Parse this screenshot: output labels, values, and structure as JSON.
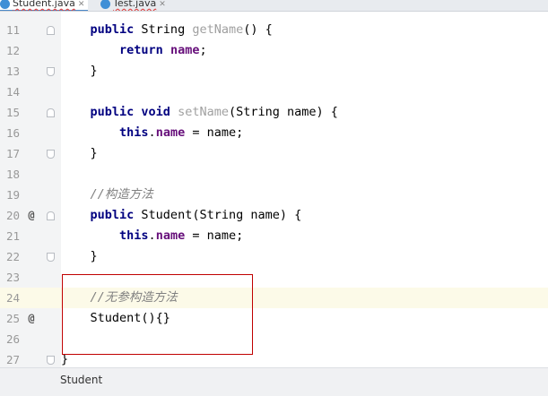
{
  "tabs": [
    {
      "label": "Student.java"
    },
    {
      "label": "Test.java"
    }
  ],
  "editor": {
    "current_line_number": "24",
    "lines": [
      {
        "num": "11",
        "indent": "    ",
        "tokens": [
          {
            "t": "public",
            "c": "kw"
          },
          {
            "t": " String ",
            "c": ""
          },
          {
            "t": "getName",
            "c": "fn"
          },
          {
            "t": "() {",
            "c": ""
          }
        ]
      },
      {
        "num": "12",
        "indent": "        ",
        "tokens": [
          {
            "t": "return",
            "c": "kw"
          },
          {
            "t": " ",
            "c": ""
          },
          {
            "t": "name",
            "c": "fld"
          },
          {
            "t": ";",
            "c": ""
          }
        ]
      },
      {
        "num": "13",
        "indent": "    ",
        "tokens": [
          {
            "t": "}",
            "c": ""
          }
        ]
      },
      {
        "num": "14",
        "indent": "",
        "tokens": []
      },
      {
        "num": "15",
        "indent": "    ",
        "tokens": [
          {
            "t": "public void",
            "c": "kw"
          },
          {
            "t": " ",
            "c": ""
          },
          {
            "t": "setName",
            "c": "fn"
          },
          {
            "t": "(String name) {",
            "c": ""
          }
        ]
      },
      {
        "num": "16",
        "indent": "        ",
        "tokens": [
          {
            "t": "this",
            "c": "kw"
          },
          {
            "t": ".",
            "c": ""
          },
          {
            "t": "name",
            "c": "fld"
          },
          {
            "t": " = name;",
            "c": ""
          }
        ]
      },
      {
        "num": "17",
        "indent": "    ",
        "tokens": [
          {
            "t": "}",
            "c": ""
          }
        ]
      },
      {
        "num": "18",
        "indent": "",
        "tokens": []
      },
      {
        "num": "19",
        "indent": "    ",
        "tokens": [
          {
            "t": "//构造方法",
            "c": "cm"
          }
        ]
      },
      {
        "num": "20",
        "indent": "    ",
        "marker": "@",
        "tokens": [
          {
            "t": "public",
            "c": "kw"
          },
          {
            "t": " Student(String name) {",
            "c": ""
          }
        ]
      },
      {
        "num": "21",
        "indent": "        ",
        "tokens": [
          {
            "t": "this",
            "c": "kw"
          },
          {
            "t": ".",
            "c": ""
          },
          {
            "t": "name",
            "c": "fld"
          },
          {
            "t": " = name;",
            "c": ""
          }
        ]
      },
      {
        "num": "22",
        "indent": "    ",
        "tokens": [
          {
            "t": "}",
            "c": ""
          }
        ]
      },
      {
        "num": "23",
        "indent": "",
        "tokens": []
      },
      {
        "num": "24",
        "indent": "    ",
        "tokens": [
          {
            "t": "//无参构造方法",
            "c": "cm"
          }
        ]
      },
      {
        "num": "25",
        "indent": "    ",
        "marker": "@",
        "tokens": [
          {
            "t": "Student(){}",
            "c": ""
          }
        ]
      },
      {
        "num": "26",
        "indent": "",
        "tokens": []
      },
      {
        "num": "27",
        "indent": "",
        "tokens": [
          {
            "t": "}",
            "c": ""
          }
        ]
      }
    ]
  },
  "breadcrumb": {
    "label": "Student"
  },
  "colors": {
    "keyword": "#000080",
    "field": "#660e7a",
    "comment": "#808080",
    "method_name": "#a0a0a0",
    "annotation_box": "#c00000"
  }
}
